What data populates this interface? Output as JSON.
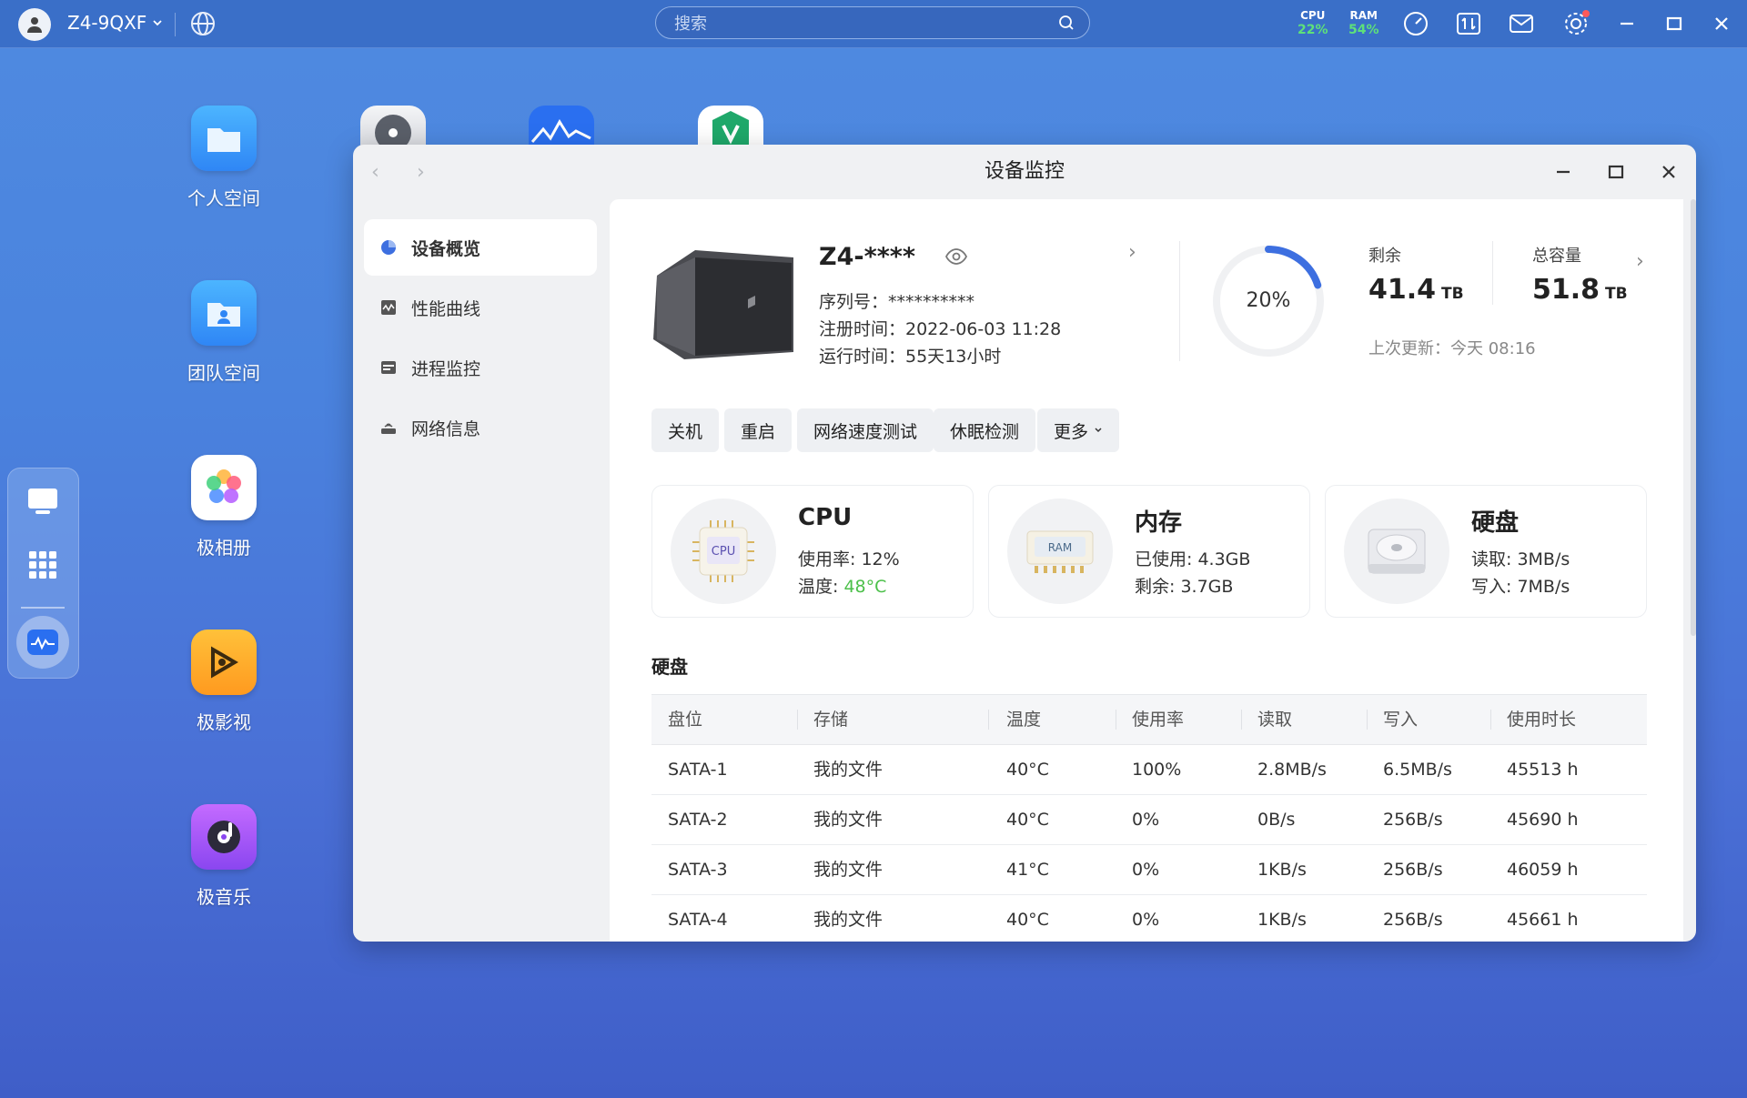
{
  "topbar": {
    "device_name": "Z4-9QXF",
    "search_placeholder": "搜索",
    "cpu_label": "CPU",
    "cpu_value": "22%",
    "ram_label": "RAM",
    "ram_value": "54%"
  },
  "desktop": {
    "icons": [
      {
        "label": "个人空间"
      },
      {
        "label": "团队空间"
      },
      {
        "label": "极相册"
      },
      {
        "label": "极影视"
      },
      {
        "label": "极音乐"
      }
    ]
  },
  "window": {
    "title": "设备监控",
    "sidebar": [
      {
        "label": "设备概览",
        "icon": "overview-icon",
        "selected": true
      },
      {
        "label": "性能曲线",
        "icon": "chart-icon"
      },
      {
        "label": "进程监控",
        "icon": "process-icon"
      },
      {
        "label": "网络信息",
        "icon": "router-icon"
      }
    ],
    "device": {
      "name": "Z4-****",
      "serial": "序列号：**********",
      "registered": "注册时间：2022-06-03 11:28",
      "uptime": "运行时间：55天13小时"
    },
    "storage": {
      "used_pct_label": "20%",
      "used_fraction": 0.2,
      "free_label": "剩余",
      "free_value": "41.4",
      "free_unit": "TB",
      "total_label": "总容量",
      "total_value": "51.8",
      "total_unit": "TB",
      "updated": "上次更新：今天 08:16"
    },
    "actions": [
      "关机",
      "重启",
      "网络速度测试",
      "休眠检测",
      "更多"
    ],
    "cards": {
      "cpu": {
        "title": "CPU",
        "usage": "使用率: 12%",
        "temp_label": "温度: ",
        "temp_value": "48°C",
        "chip_text": "CPU"
      },
      "ram": {
        "title": "内存",
        "used": "已使用: 4.3GB",
        "free": "剩余: 3.7GB",
        "chip_text": "RAM"
      },
      "disk": {
        "title": "硬盘",
        "read": "读取: 3MB/s",
        "write": "写入: 7MB/s"
      }
    },
    "disk_section_title": "硬盘",
    "disk_table": {
      "headers": [
        "盘位",
        "存储",
        "温度",
        "使用率",
        "读取",
        "写入",
        "使用时长"
      ],
      "rows": [
        [
          "SATA-1",
          "我的文件",
          "40°C",
          "100%",
          "2.8MB/s",
          "6.5MB/s",
          "45513 h"
        ],
        [
          "SATA-2",
          "我的文件",
          "40°C",
          "0%",
          "0B/s",
          "256B/s",
          "45690 h"
        ],
        [
          "SATA-3",
          "我的文件",
          "41°C",
          "0%",
          "1KB/s",
          "256B/s",
          "46059 h"
        ],
        [
          "SATA-4",
          "我的文件",
          "40°C",
          "0%",
          "1KB/s",
          "256B/s",
          "45661 h"
        ]
      ]
    }
  },
  "colors": {
    "accent": "#3d6fe0",
    "temp_green": "#4cc04a",
    "stat_green": "#5ee07a"
  }
}
